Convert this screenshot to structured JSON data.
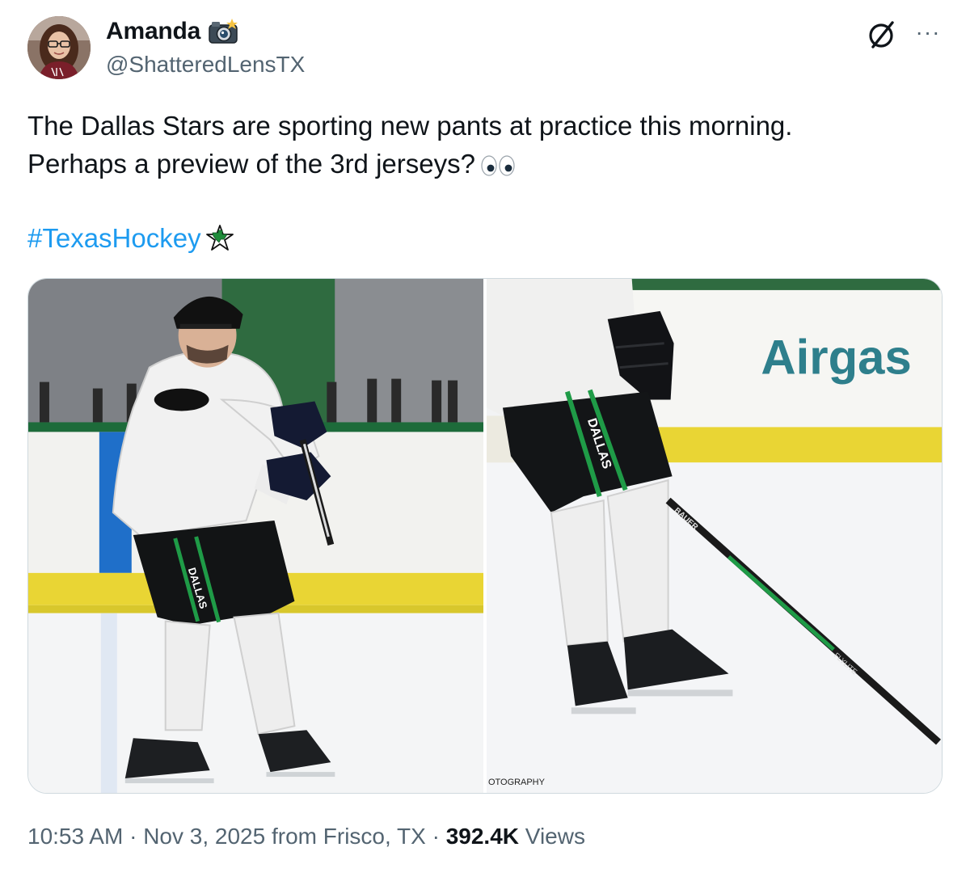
{
  "author": {
    "display_name": "Amanda",
    "handle": "@ShatteredLensTX",
    "badge_icon": "camera-flash-icon"
  },
  "tweet": {
    "line1": "The Dallas Stars are sporting new pants at practice this morning.",
    "line2": "Perhaps a preview of the 3rd jerseys?",
    "emoji": "eyes-icon",
    "hashtag": "#TexasHockey",
    "hashtag_emoji": "dallas-stars-logo-icon"
  },
  "media": {
    "left_pant_text": "DALLAS",
    "right_pant_text": "DALLAS",
    "right_ad_text": "Airgas",
    "right_watermark": "OTOGRAPHY",
    "stick_brand": "BAUER",
    "stick_model": "FLYLITE"
  },
  "meta": {
    "time": "10:53 AM",
    "sep1": " · ",
    "date": "Nov 3, 2025",
    "location": " from Frisco, TX",
    "sep2": " · ",
    "views_count": "392.4K",
    "views_label": " Views"
  },
  "colors": {
    "link": "#1d9bf0",
    "secondary_text": "#536471",
    "primary_text": "#0f1419",
    "stars_green": "#1e8c3a"
  }
}
